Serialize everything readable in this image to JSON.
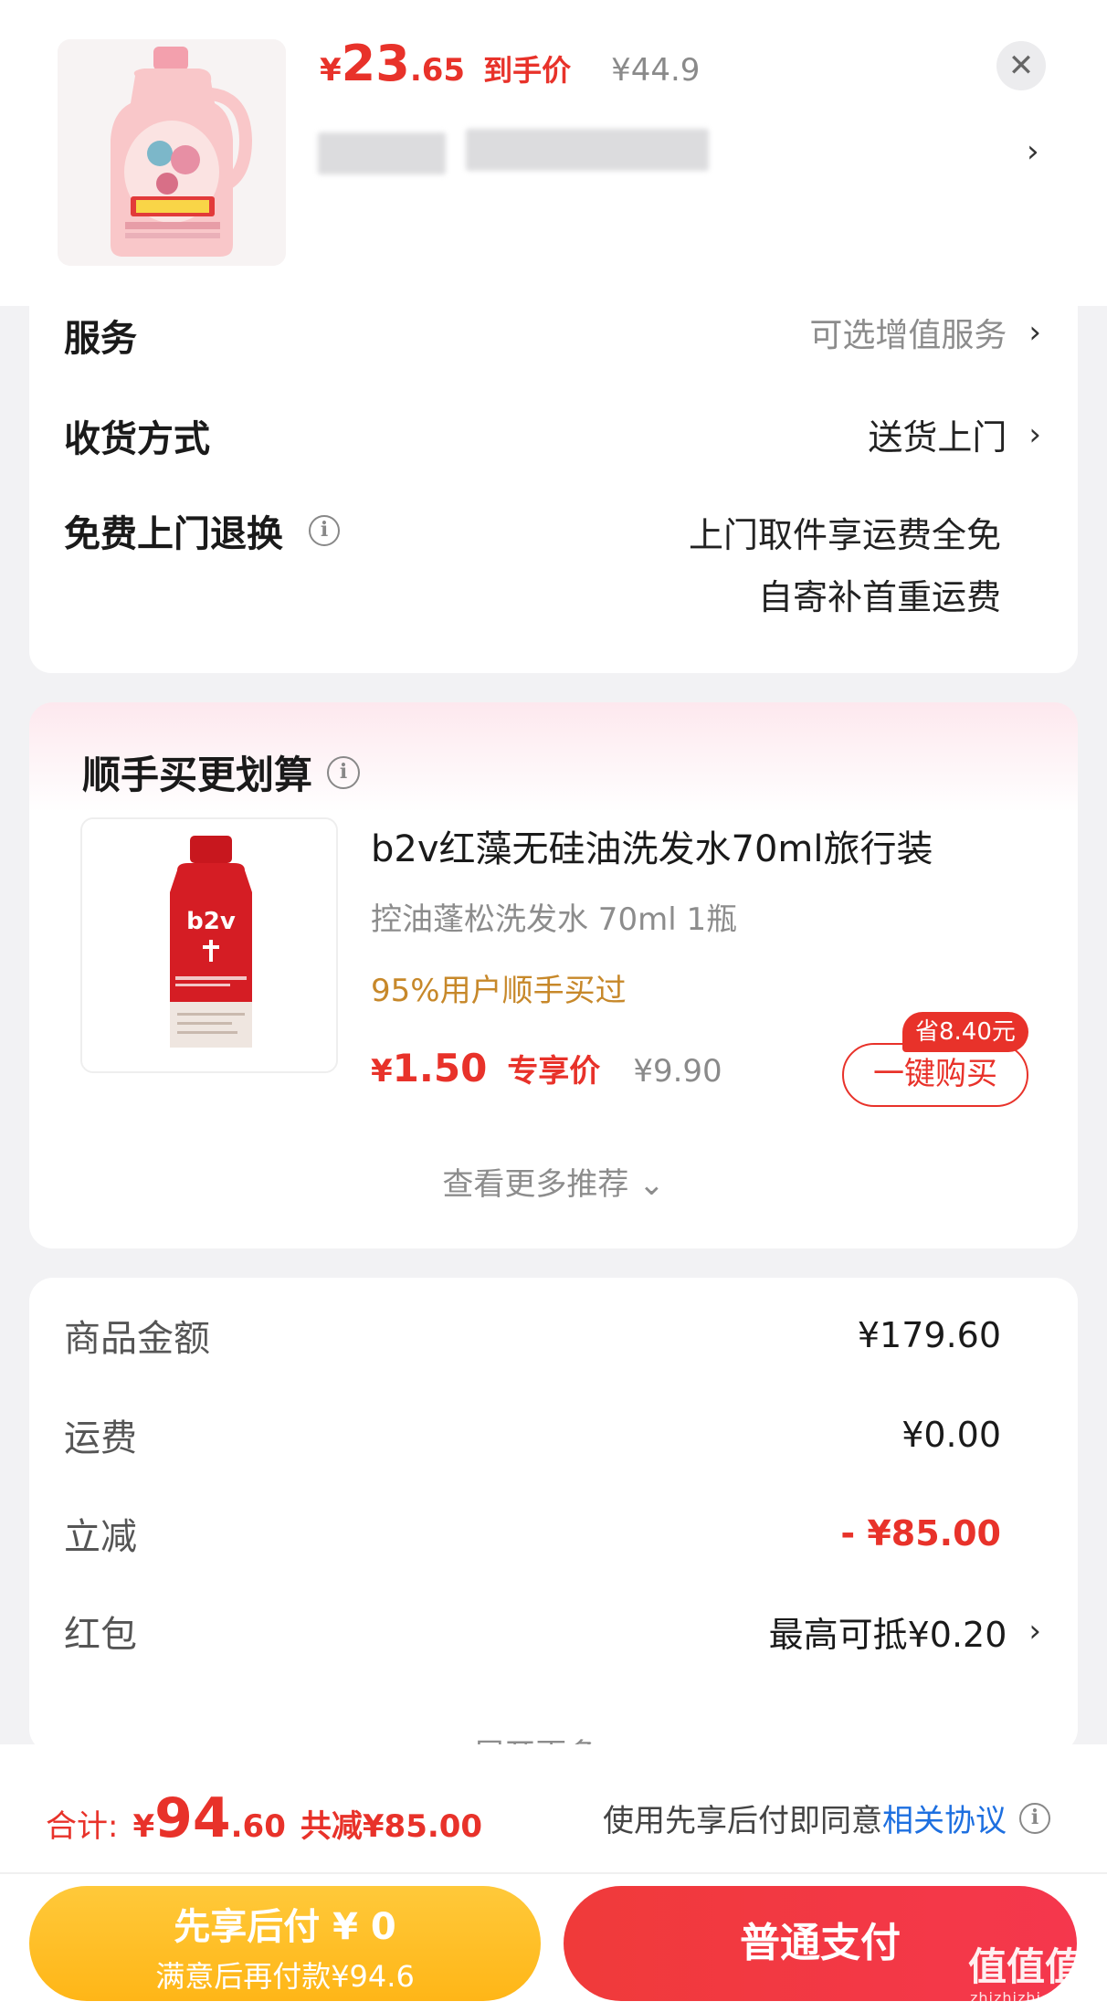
{
  "header": {
    "price_yen": "¥",
    "price_int": "23",
    "price_dec": ".65",
    "price_tag": "到手价",
    "original_price": "¥44.9",
    "close_label": "✕",
    "detail_arrow": "›"
  },
  "services": {
    "service_label": "服务",
    "service_value": "可选增值服务",
    "delivery_label": "收货方式",
    "delivery_value": "送货上门",
    "return_label": "免费上门退换",
    "return_value_line1": "上门取件享运费全免",
    "return_value_line2": "自寄补首重运费",
    "arrow": "›",
    "info_glyph": "i"
  },
  "bundle": {
    "title": "顺手买更划算",
    "product_name": "b2v红藻无硅油洗发水70ml旅行装",
    "product_spec": "控油蓬松洗发水 70ml 1瓶",
    "popularity": "95%用户顺手买过",
    "price_yen": "¥",
    "price_num": "1.50",
    "price_tag": "专享价",
    "original_price": "¥9.90",
    "save_badge": "省8.40元",
    "buy_button": "一键购买",
    "more_recommend": "查看更多推荐 ⌄",
    "bottle_brand": "b2v"
  },
  "summary": {
    "goods_label": "商品金额",
    "goods_value": "¥179.60",
    "shipping_label": "运费",
    "shipping_value": "¥0.00",
    "discount_label": "立减",
    "discount_value": "- ¥85.00",
    "redpacket_label": "红包",
    "redpacket_value": "最高可抵¥0.20",
    "expand_more": "展开更多 ⌄"
  },
  "bottom": {
    "total_label": "合计:",
    "total_yen": "¥",
    "total_int": "94",
    "total_dec": ".60",
    "total_discount": "共减¥85.00",
    "agree_text": "使用先享后付即同意",
    "agree_link": "相关协议",
    "bnpl_line1": "先享后付 ¥ 0",
    "bnpl_line2": "满意后再付款¥94.6",
    "pay_button": "普通支付"
  },
  "watermark": {
    "text": "值值值",
    "sub": "zhizhizhi.com"
  },
  "colors": {
    "accent_red": "#e8322a",
    "gold": "#c7882a",
    "bnpl_yellow": "#ffb617",
    "link_blue": "#1d6fe0"
  }
}
